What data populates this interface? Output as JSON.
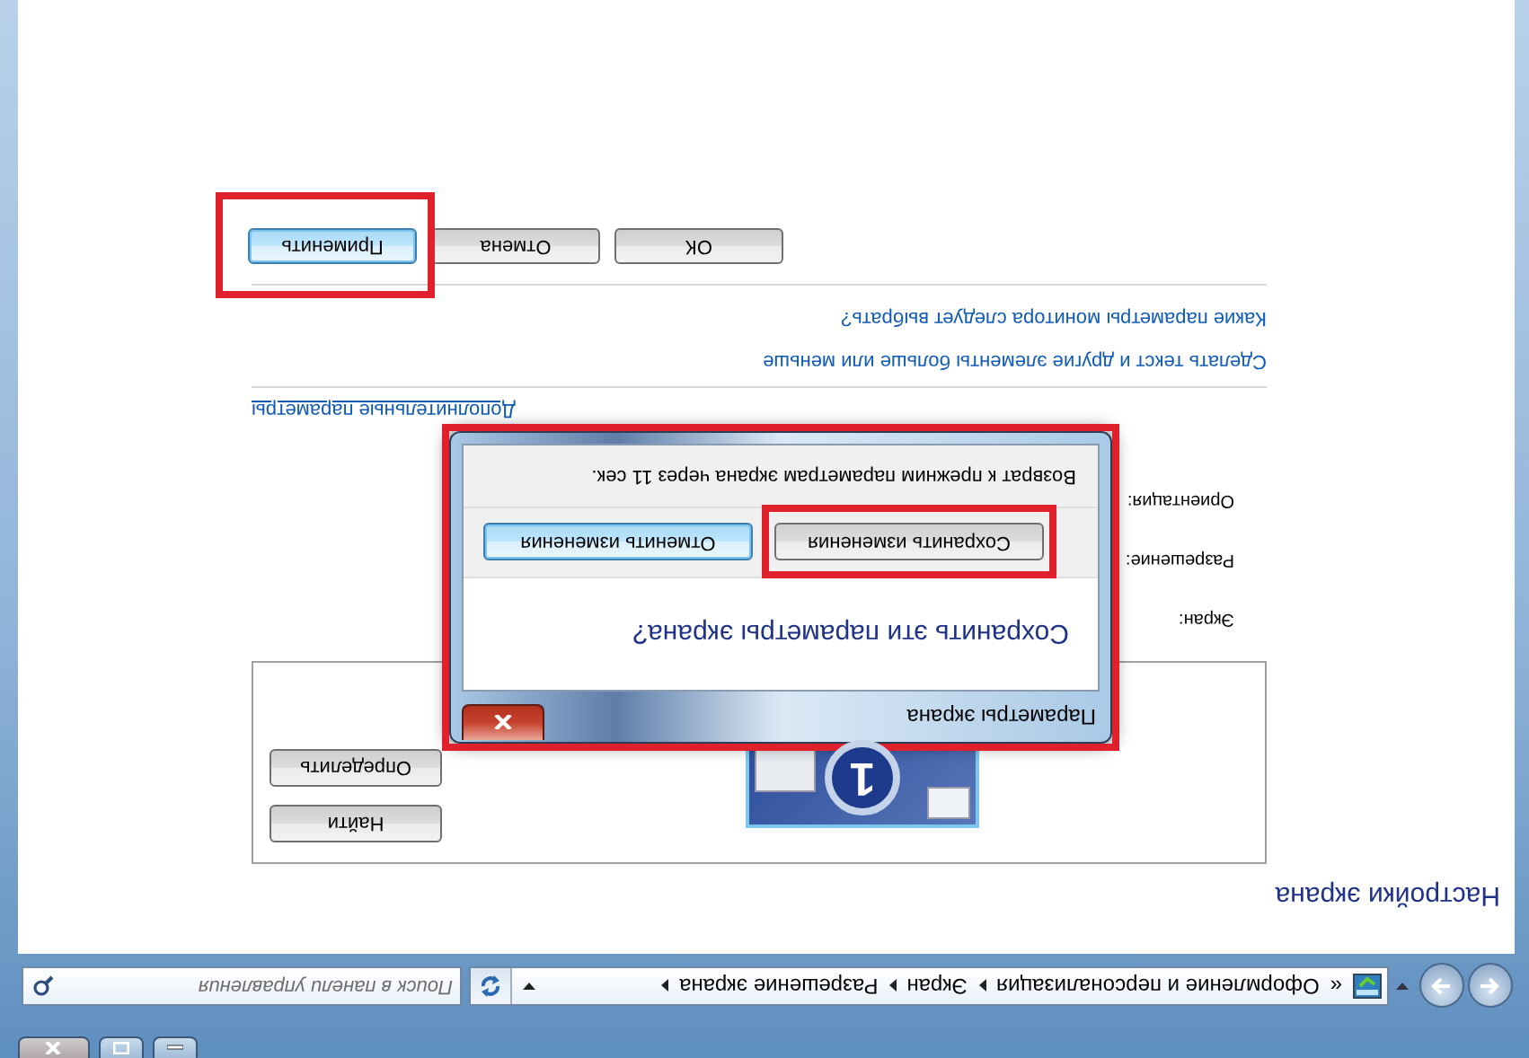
{
  "window": {
    "caption_buttons": [
      {
        "kind": "minimize"
      },
      {
        "kind": "maximize"
      },
      {
        "kind": "close"
      }
    ]
  },
  "address_bar": {
    "overflow": "«",
    "breadcrumbs": [
      "Оформление и персонализация",
      "Экран",
      "Разрешение экрана"
    ]
  },
  "search": {
    "placeholder": "Поиск в панели управления"
  },
  "page": {
    "title": "Настройки экрана",
    "monitor": {
      "number": "1"
    },
    "monitor_buttons": [
      {
        "label": "Найти"
      },
      {
        "label": "Определить"
      }
    ],
    "settings": [
      {
        "label": "Экран:"
      },
      {
        "label": "Разрешение:"
      },
      {
        "label": "Ориентация:"
      }
    ],
    "advanced_link": "Дополнительные параметры",
    "links": [
      "Сделать текст и другие элементы больше или меньше",
      "Какие параметры монитора следует выбрать?"
    ],
    "buttons": [
      {
        "label": "ОК",
        "focused": false,
        "highlighted": false
      },
      {
        "label": "Отмена",
        "focused": false,
        "highlighted": false
      },
      {
        "label": "Применить",
        "focused": true,
        "highlighted": true
      }
    ]
  },
  "dialog": {
    "title": "Параметры экрана",
    "highlighted": true,
    "question": "Сохранить эти параметры экрана?",
    "buttons": [
      {
        "label": "Сохранить изменения",
        "focused": false,
        "highlighted": true
      },
      {
        "label": "Отменить изменения",
        "focused": true,
        "highlighted": false
      }
    ],
    "countdown": "Возврат к прежним параметрам экрана через 11 сек."
  }
}
